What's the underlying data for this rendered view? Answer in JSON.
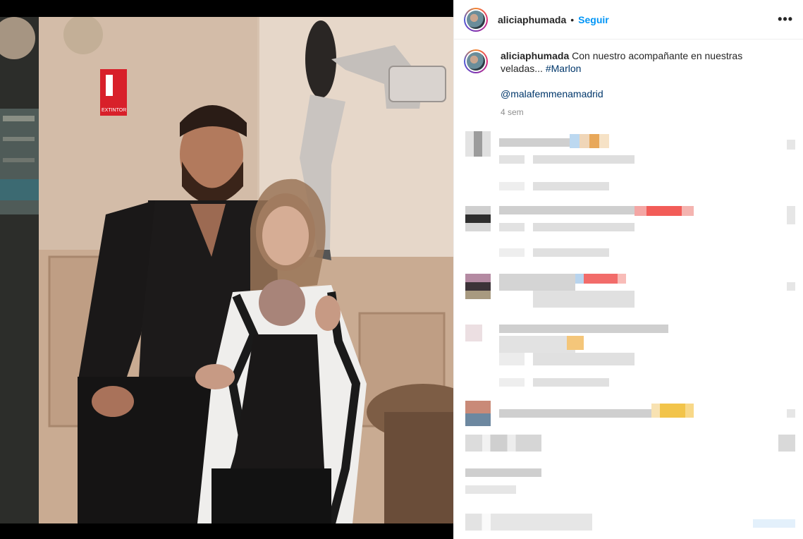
{
  "post": {
    "username": "aliciaphumada",
    "follow_label": "Seguir",
    "separator": "•",
    "more_icon": "•••"
  },
  "caption": {
    "username": "aliciaphumada",
    "text": "Con nuestro acompañante en nuestras veladas... ",
    "hashtag": "#Marlon",
    "mention": "@malafemmenamadrid",
    "time": "4 sem"
  },
  "photo": {
    "sign_text": "EXTINTOR"
  }
}
